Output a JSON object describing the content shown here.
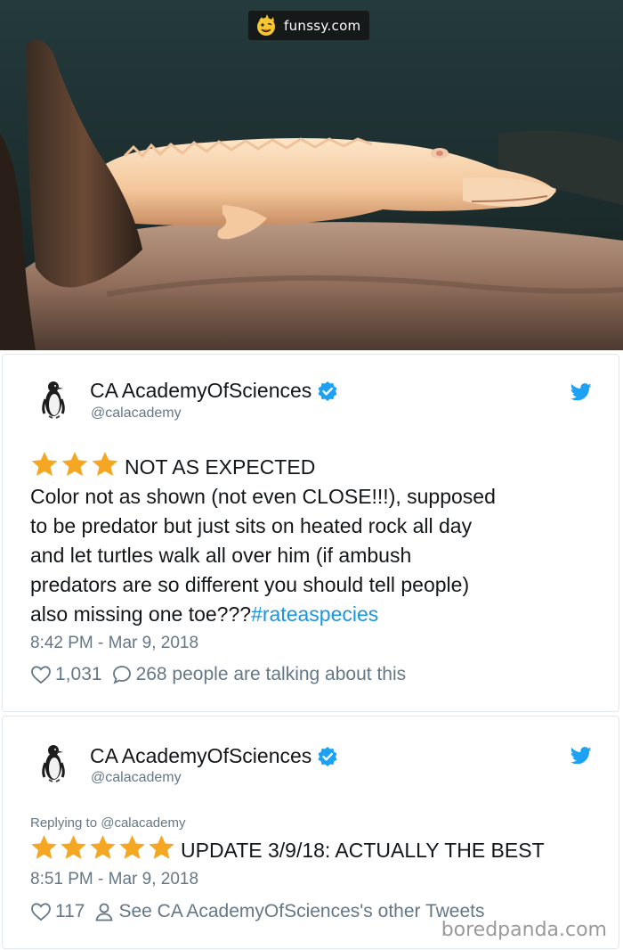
{
  "photo": {
    "site_name": "funssy.com",
    "mascot_icon": "smiling-sun-mascot"
  },
  "tweets": [
    {
      "display_name": "CA AcademyOfSciences",
      "handle": "@calacademy",
      "avatar_icon": "penguin-avatar",
      "verified_icon": "verified-badge",
      "service_icon": "twitter-bird",
      "stars": 3,
      "headline": "NOT AS EXPECTED",
      "body_lines": [
        "Color not as shown (not even CLOSE!!!), supposed",
        "to be predator but just sits on heated rock all day",
        "and let turtles walk all over him (if ambush",
        "predators are so different you should tell people)",
        "also missing one toe???"
      ],
      "hashtag": "#rateaspecies",
      "timestamp": "8:42 PM - Mar 9, 2018",
      "likes": "1,031",
      "replies_text": "268 people are talking about this"
    },
    {
      "display_name": "CA AcademyOfSciences",
      "handle": "@calacademy",
      "avatar_icon": "penguin-avatar",
      "verified_icon": "verified-badge",
      "service_icon": "twitter-bird",
      "replying_to": "Replying to @calacademy",
      "stars": 5,
      "headline": "UPDATE 3/9/18: ACTUALLY THE BEST",
      "timestamp": "8:51 PM - Mar 9, 2018",
      "likes": "117",
      "profile_link": "See CA AcademyOfSciences's other Tweets"
    }
  ],
  "watermark": "boredpanda.com",
  "colors": {
    "link_blue": "#1b95e0",
    "star_gold": "#f5a623",
    "muted_text": "#657786",
    "verified_blue": "#1da1f2"
  }
}
